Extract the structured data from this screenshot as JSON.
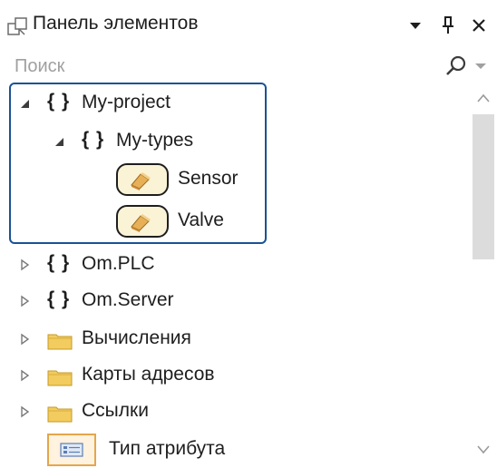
{
  "header": {
    "title": "Панель элементов",
    "icons": {
      "title": "toolbox-icon",
      "menu": "dropdown-arrow-icon",
      "pin": "pin-icon",
      "close": "close-icon"
    }
  },
  "search": {
    "placeholder": "Поиск",
    "value": "",
    "icons": [
      "search-icon",
      "dropdown-arrow-icon"
    ]
  },
  "tree": {
    "items": [
      {
        "label": "My-project",
        "kind": "namespace",
        "state": "expanded",
        "level": 0
      },
      {
        "label": "My-types",
        "kind": "namespace",
        "state": "expanded",
        "level": 1
      },
      {
        "label": "Sensor",
        "kind": "type",
        "level": 2
      },
      {
        "label": "Valve",
        "kind": "type",
        "level": 2
      },
      {
        "label": "Om.PLC",
        "kind": "namespace",
        "state": "collapsed",
        "level": 0
      },
      {
        "label": "Om.Server",
        "kind": "namespace",
        "state": "collapsed",
        "level": 0
      },
      {
        "label": "Вычисления",
        "kind": "folder",
        "state": "collapsed",
        "level": 0
      },
      {
        "label": "Карты адресов",
        "kind": "folder",
        "state": "collapsed",
        "level": 0
      },
      {
        "label": "Ссылки",
        "kind": "folder",
        "state": "collapsed",
        "level": 0
      },
      {
        "label": "Тип атрибута",
        "kind": "attribute-type",
        "level": 0
      }
    ],
    "braces_glyph": "{ }"
  },
  "colors": {
    "selection_border": "#1a5294",
    "type_chip_fill": "#fbf3d6",
    "folder_yellow": "#f2cc5e",
    "attribute_chip_border": "#e5a64a"
  }
}
